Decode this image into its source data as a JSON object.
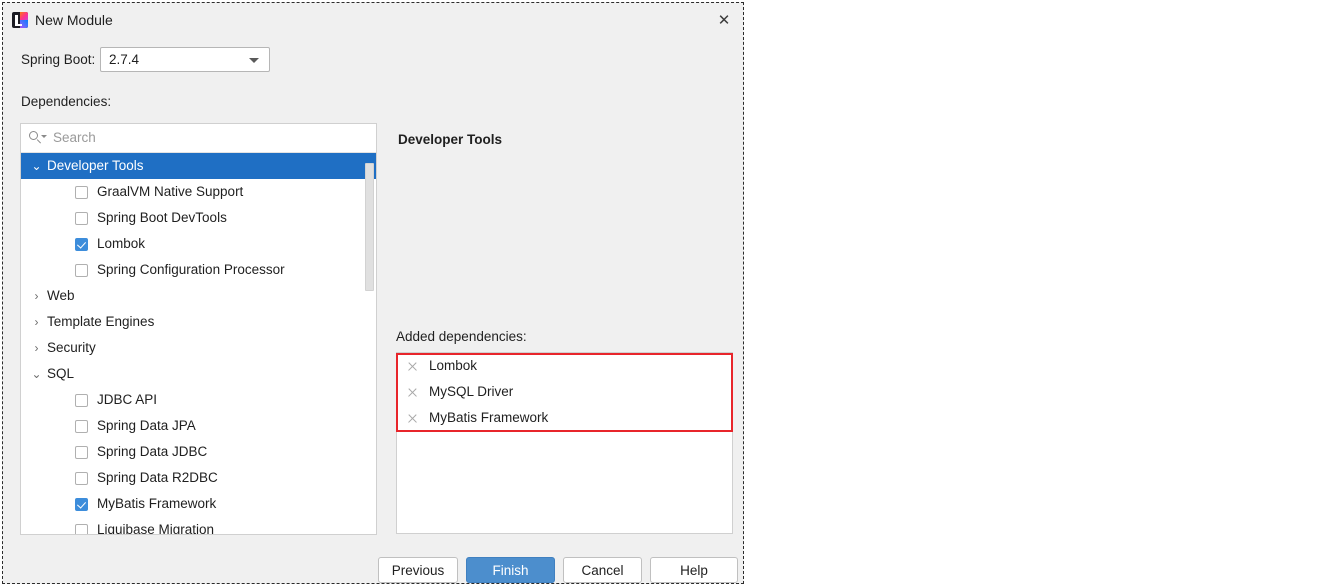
{
  "window": {
    "title": "New Module",
    "icon": "intellij-idea-icon",
    "close_label": "✕"
  },
  "form": {
    "spring_boot_label": "Spring Boot:",
    "spring_boot_value": "2.7.4",
    "dependencies_label": "Dependencies:"
  },
  "search": {
    "placeholder": "Search",
    "icon": "search-icon"
  },
  "tree": {
    "rows": [
      {
        "kind": "group",
        "label": "Developer Tools",
        "expanded": true,
        "selected": true
      },
      {
        "kind": "leaf",
        "label": "GraalVM Native Support",
        "checked": false
      },
      {
        "kind": "leaf",
        "label": "Spring Boot DevTools",
        "checked": false
      },
      {
        "kind": "leaf",
        "label": "Lombok",
        "checked": true
      },
      {
        "kind": "leaf",
        "label": "Spring Configuration Processor",
        "checked": false
      },
      {
        "kind": "group",
        "label": "Web",
        "expanded": false,
        "selected": false
      },
      {
        "kind": "group",
        "label": "Template Engines",
        "expanded": false,
        "selected": false
      },
      {
        "kind": "group",
        "label": "Security",
        "expanded": false,
        "selected": false
      },
      {
        "kind": "group",
        "label": "SQL",
        "expanded": true,
        "selected": false
      },
      {
        "kind": "leaf",
        "label": "JDBC API",
        "checked": false
      },
      {
        "kind": "leaf",
        "label": "Spring Data JPA",
        "checked": false
      },
      {
        "kind": "leaf",
        "label": "Spring Data JDBC",
        "checked": false
      },
      {
        "kind": "leaf",
        "label": "Spring Data R2DBC",
        "checked": false
      },
      {
        "kind": "leaf",
        "label": "MyBatis Framework",
        "checked": true
      },
      {
        "kind": "leaf",
        "label": "Liquibase Migration",
        "checked": false
      }
    ],
    "chevron_expanded": "⌄",
    "chevron_collapsed": "›"
  },
  "detail": {
    "title": "Developer Tools"
  },
  "added": {
    "label": "Added dependencies:",
    "items": [
      {
        "label": "Lombok",
        "remove_icon": "close-icon"
      },
      {
        "label": "MySQL Driver",
        "remove_icon": "close-icon"
      },
      {
        "label": "MyBatis Framework",
        "remove_icon": "close-icon"
      }
    ]
  },
  "annotation": {
    "color": "#e8252b"
  },
  "footer": {
    "previous": "Previous",
    "finish": "Finish",
    "cancel": "Cancel",
    "help": "Help"
  },
  "colors": {
    "selection_blue": "#1f6fc4",
    "checkbox_blue": "#3d8ddb",
    "primary_button": "#4c8ecd",
    "dialog_background": "#f0f0f0"
  }
}
